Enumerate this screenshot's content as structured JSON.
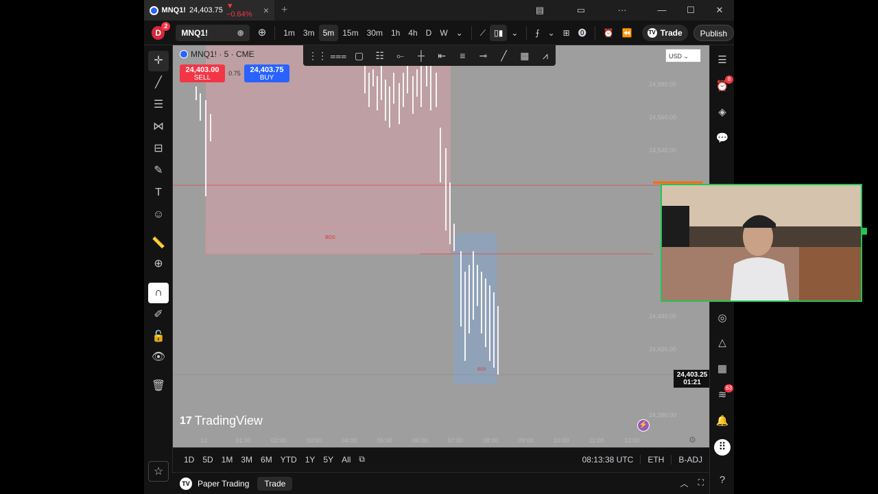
{
  "window": {
    "tab_symbol": "MNQ1!",
    "tab_price": "24,403.75",
    "tab_change": "▼ −0.64%",
    "tab_close": "×",
    "new_tab": "+",
    "min": "—",
    "max": "☐",
    "close": "✕"
  },
  "toolbar": {
    "avatar_letter": "D",
    "avatar_badge": "2",
    "symbol": "MNQ1!",
    "intervals": [
      "1m",
      "3m",
      "5m",
      "15m",
      "30m",
      "1h",
      "4h",
      "D",
      "W"
    ],
    "active_interval": "5m",
    "trade_label": "Trade",
    "publish_label": "Publish"
  },
  "chart": {
    "legend_title": "MNQ1! · 5 · CME",
    "sell_price": "24,403.00",
    "sell_label": "SELL",
    "buy_price": "24,403.75",
    "buy_label": "BUY",
    "spread": "0.75",
    "currency": "USD",
    "y_ticks": [
      "24,580.00",
      "24,560.00",
      "24,540.00",
      "24,440.00",
      "24,420.00",
      "24,380.00"
    ],
    "x_ticks": [
      "13",
      "01:00",
      "02:00",
      "03:00",
      "04:00",
      "05:00",
      "06:00",
      "07:00",
      "08:00",
      "09:00",
      "10:00",
      "11:00",
      "12:00"
    ],
    "last_price": "24,403.25",
    "countdown": "01:21",
    "watermark": "TradingView",
    "box_label_top": "BOS",
    "box_label_bottom": "BOS"
  },
  "bottom": {
    "ranges": [
      "1D",
      "5D",
      "1M",
      "3M",
      "6M",
      "YTD",
      "1Y",
      "5Y",
      "All"
    ],
    "time": "08:13:38 UTC",
    "session": "ETH",
    "adj": "B-ADJ"
  },
  "footer": {
    "paper_trading": "Paper Trading",
    "trade": "Trade"
  },
  "right_badges": {
    "alerts": "8",
    "feed": "63"
  }
}
